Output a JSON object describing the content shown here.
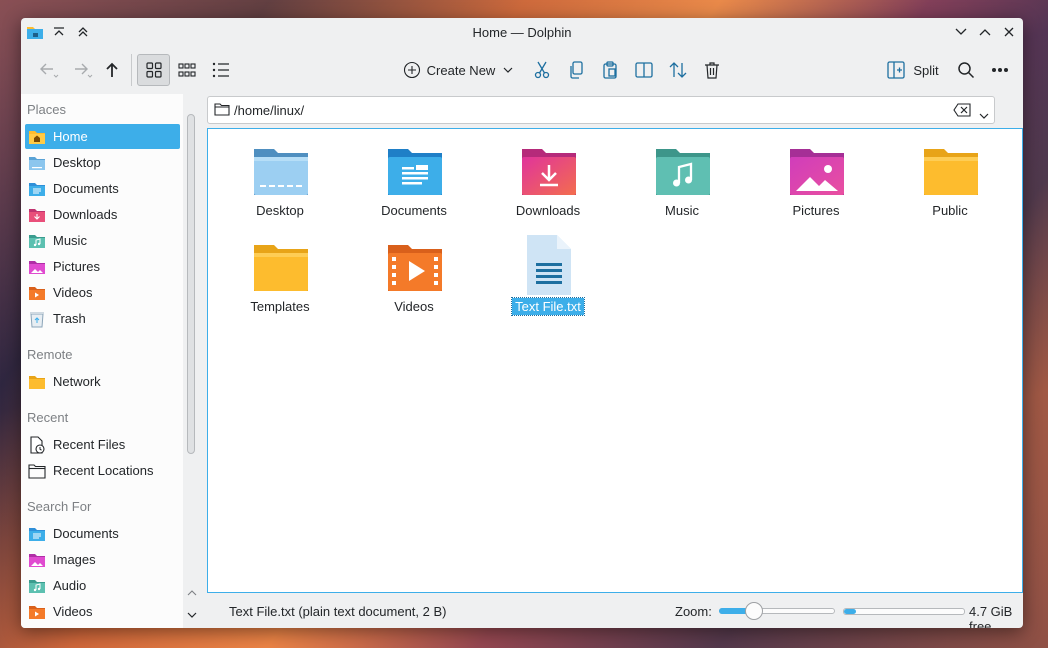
{
  "window": {
    "title": "Home — Dolphin"
  },
  "toolbar": {
    "create_new_label": "Create New",
    "split_label": "Split"
  },
  "places": {
    "sections": [
      {
        "title": "Places",
        "items": [
          {
            "label": "Home",
            "icon": "home-folder-icon",
            "selected": true
          },
          {
            "label": "Desktop",
            "icon": "desktop-folder-icon"
          },
          {
            "label": "Documents",
            "icon": "documents-folder-icon"
          },
          {
            "label": "Downloads",
            "icon": "downloads-folder-icon"
          },
          {
            "label": "Music",
            "icon": "music-folder-icon"
          },
          {
            "label": "Pictures",
            "icon": "pictures-folder-icon"
          },
          {
            "label": "Videos",
            "icon": "videos-folder-icon"
          },
          {
            "label": "Trash",
            "icon": "trash-icon"
          }
        ]
      },
      {
        "title": "Remote",
        "items": [
          {
            "label": "Network",
            "icon": "network-folder-icon"
          }
        ]
      },
      {
        "title": "Recent",
        "items": [
          {
            "label": "Recent Files",
            "icon": "recent-files-icon"
          },
          {
            "label": "Recent Locations",
            "icon": "recent-locations-icon"
          }
        ]
      },
      {
        "title": "Search For",
        "items": [
          {
            "label": "Documents",
            "icon": "documents-folder-icon"
          },
          {
            "label": "Images",
            "icon": "pictures-folder-icon"
          },
          {
            "label": "Audio",
            "icon": "music-folder-icon"
          },
          {
            "label": "Videos",
            "icon": "videos-folder-icon"
          }
        ]
      }
    ]
  },
  "location": {
    "path": "/home/linux/"
  },
  "files": [
    {
      "name": "Desktop",
      "icon": "desktop-folder-icon"
    },
    {
      "name": "Documents",
      "icon": "documents-folder-icon"
    },
    {
      "name": "Downloads",
      "icon": "downloads-folder-icon"
    },
    {
      "name": "Music",
      "icon": "music-folder-icon"
    },
    {
      "name": "Pictures",
      "icon": "pictures-folder-icon"
    },
    {
      "name": "Public",
      "icon": "public-folder-icon"
    },
    {
      "name": "Templates",
      "icon": "templates-folder-icon"
    },
    {
      "name": "Videos",
      "icon": "videos-folder-icon"
    },
    {
      "name": "Text File.txt",
      "icon": "text-file-icon",
      "selected": true
    }
  ],
  "status": {
    "text": "Text File.txt (plain text document, 2 B)",
    "zoom_label": "Zoom:",
    "zoom_fraction": 0.3,
    "space_used_fraction": 0.1,
    "free_space": "4.7 GiB free"
  },
  "colors": {
    "accent": "#3daee9",
    "folder_blue": "#3daee9",
    "folder_yellow": "#fdbc2e",
    "folder_pink": "#e93d8a",
    "folder_teal": "#4fb7a8",
    "folder_magenta": "#d03dbb",
    "folder_orange": "#f47a29"
  }
}
